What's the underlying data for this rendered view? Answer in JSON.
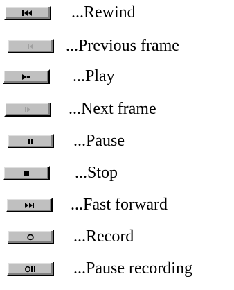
{
  "legend": {
    "items": [
      {
        "icon": "rewind-icon",
        "label": "...Rewind",
        "enabled": true
      },
      {
        "icon": "previous-frame-icon",
        "label": "...Previous frame",
        "enabled": false
      },
      {
        "icon": "play-icon",
        "label": "...Play",
        "enabled": true
      },
      {
        "icon": "next-frame-icon",
        "label": "...Next frame",
        "enabled": false
      },
      {
        "icon": "pause-icon",
        "label": "...Pause",
        "enabled": true
      },
      {
        "icon": "stop-icon",
        "label": "...Stop",
        "enabled": true
      },
      {
        "icon": "fast-forward-icon",
        "label": "...Fast forward",
        "enabled": true
      },
      {
        "icon": "record-icon",
        "label": "...Record",
        "enabled": true
      },
      {
        "icon": "pause-recording-icon",
        "label": "...Pause recording",
        "enabled": true
      }
    ]
  },
  "colors": {
    "button_face": "#c0c0c0",
    "glyph": "#000000",
    "glyph_disabled": "#a0a0a0",
    "text": "#000000"
  }
}
